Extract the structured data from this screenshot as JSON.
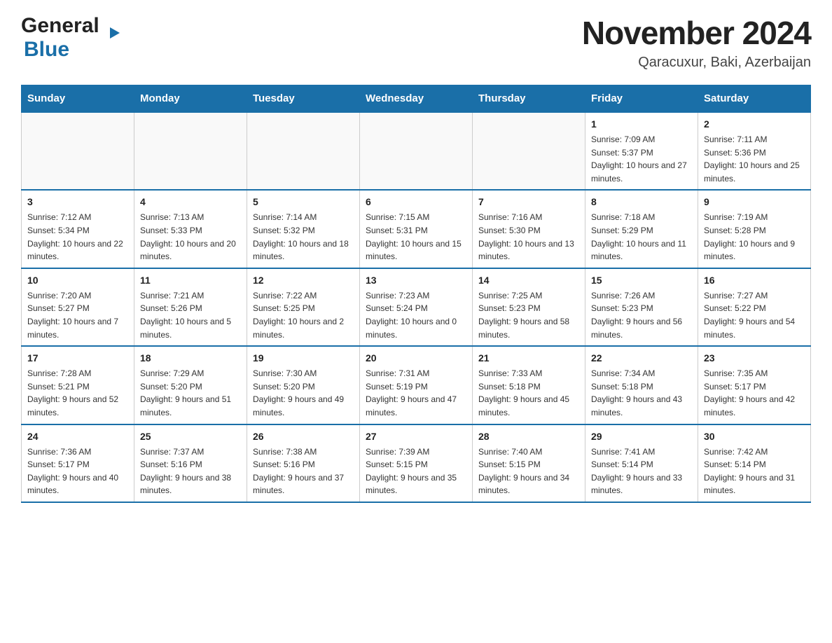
{
  "header": {
    "logo": {
      "general": "General",
      "blue": "Blue",
      "triangle": "▶"
    },
    "month_year": "November 2024",
    "location": "Qaracuxur, Baki, Azerbaijan"
  },
  "weekdays": [
    "Sunday",
    "Monday",
    "Tuesday",
    "Wednesday",
    "Thursday",
    "Friday",
    "Saturday"
  ],
  "weeks": [
    [
      {
        "day": "",
        "info": ""
      },
      {
        "day": "",
        "info": ""
      },
      {
        "day": "",
        "info": ""
      },
      {
        "day": "",
        "info": ""
      },
      {
        "day": "",
        "info": ""
      },
      {
        "day": "1",
        "info": "Sunrise: 7:09 AM\nSunset: 5:37 PM\nDaylight: 10 hours and 27 minutes."
      },
      {
        "day": "2",
        "info": "Sunrise: 7:11 AM\nSunset: 5:36 PM\nDaylight: 10 hours and 25 minutes."
      }
    ],
    [
      {
        "day": "3",
        "info": "Sunrise: 7:12 AM\nSunset: 5:34 PM\nDaylight: 10 hours and 22 minutes."
      },
      {
        "day": "4",
        "info": "Sunrise: 7:13 AM\nSunset: 5:33 PM\nDaylight: 10 hours and 20 minutes."
      },
      {
        "day": "5",
        "info": "Sunrise: 7:14 AM\nSunset: 5:32 PM\nDaylight: 10 hours and 18 minutes."
      },
      {
        "day": "6",
        "info": "Sunrise: 7:15 AM\nSunset: 5:31 PM\nDaylight: 10 hours and 15 minutes."
      },
      {
        "day": "7",
        "info": "Sunrise: 7:16 AM\nSunset: 5:30 PM\nDaylight: 10 hours and 13 minutes."
      },
      {
        "day": "8",
        "info": "Sunrise: 7:18 AM\nSunset: 5:29 PM\nDaylight: 10 hours and 11 minutes."
      },
      {
        "day": "9",
        "info": "Sunrise: 7:19 AM\nSunset: 5:28 PM\nDaylight: 10 hours and 9 minutes."
      }
    ],
    [
      {
        "day": "10",
        "info": "Sunrise: 7:20 AM\nSunset: 5:27 PM\nDaylight: 10 hours and 7 minutes."
      },
      {
        "day": "11",
        "info": "Sunrise: 7:21 AM\nSunset: 5:26 PM\nDaylight: 10 hours and 5 minutes."
      },
      {
        "day": "12",
        "info": "Sunrise: 7:22 AM\nSunset: 5:25 PM\nDaylight: 10 hours and 2 minutes."
      },
      {
        "day": "13",
        "info": "Sunrise: 7:23 AM\nSunset: 5:24 PM\nDaylight: 10 hours and 0 minutes."
      },
      {
        "day": "14",
        "info": "Sunrise: 7:25 AM\nSunset: 5:23 PM\nDaylight: 9 hours and 58 minutes."
      },
      {
        "day": "15",
        "info": "Sunrise: 7:26 AM\nSunset: 5:23 PM\nDaylight: 9 hours and 56 minutes."
      },
      {
        "day": "16",
        "info": "Sunrise: 7:27 AM\nSunset: 5:22 PM\nDaylight: 9 hours and 54 minutes."
      }
    ],
    [
      {
        "day": "17",
        "info": "Sunrise: 7:28 AM\nSunset: 5:21 PM\nDaylight: 9 hours and 52 minutes."
      },
      {
        "day": "18",
        "info": "Sunrise: 7:29 AM\nSunset: 5:20 PM\nDaylight: 9 hours and 51 minutes."
      },
      {
        "day": "19",
        "info": "Sunrise: 7:30 AM\nSunset: 5:20 PM\nDaylight: 9 hours and 49 minutes."
      },
      {
        "day": "20",
        "info": "Sunrise: 7:31 AM\nSunset: 5:19 PM\nDaylight: 9 hours and 47 minutes."
      },
      {
        "day": "21",
        "info": "Sunrise: 7:33 AM\nSunset: 5:18 PM\nDaylight: 9 hours and 45 minutes."
      },
      {
        "day": "22",
        "info": "Sunrise: 7:34 AM\nSunset: 5:18 PM\nDaylight: 9 hours and 43 minutes."
      },
      {
        "day": "23",
        "info": "Sunrise: 7:35 AM\nSunset: 5:17 PM\nDaylight: 9 hours and 42 minutes."
      }
    ],
    [
      {
        "day": "24",
        "info": "Sunrise: 7:36 AM\nSunset: 5:17 PM\nDaylight: 9 hours and 40 minutes."
      },
      {
        "day": "25",
        "info": "Sunrise: 7:37 AM\nSunset: 5:16 PM\nDaylight: 9 hours and 38 minutes."
      },
      {
        "day": "26",
        "info": "Sunrise: 7:38 AM\nSunset: 5:16 PM\nDaylight: 9 hours and 37 minutes."
      },
      {
        "day": "27",
        "info": "Sunrise: 7:39 AM\nSunset: 5:15 PM\nDaylight: 9 hours and 35 minutes."
      },
      {
        "day": "28",
        "info": "Sunrise: 7:40 AM\nSunset: 5:15 PM\nDaylight: 9 hours and 34 minutes."
      },
      {
        "day": "29",
        "info": "Sunrise: 7:41 AM\nSunset: 5:14 PM\nDaylight: 9 hours and 33 minutes."
      },
      {
        "day": "30",
        "info": "Sunrise: 7:42 AM\nSunset: 5:14 PM\nDaylight: 9 hours and 31 minutes."
      }
    ]
  ]
}
